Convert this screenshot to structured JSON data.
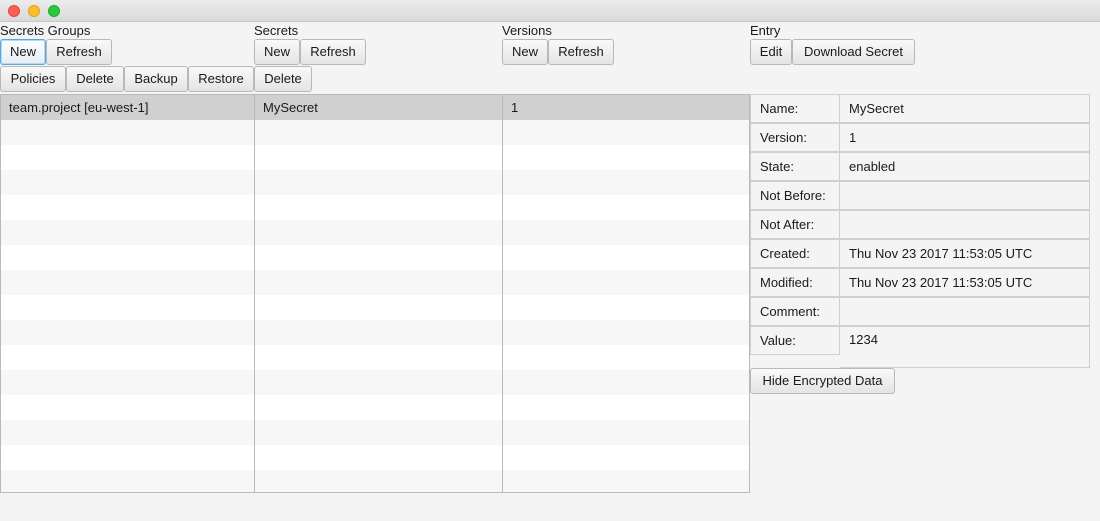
{
  "window": {
    "controls": [
      "close",
      "minimize",
      "maximize"
    ]
  },
  "groups": {
    "label": "Secrets Groups",
    "new_label": "New",
    "refresh_label": "Refresh",
    "policies_label": "Policies",
    "delete_label": "Delete",
    "backup_label": "Backup",
    "restore_label": "Restore",
    "items": [
      "team.project [eu-west-1]"
    ]
  },
  "secrets": {
    "label": "Secrets",
    "new_label": "New",
    "refresh_label": "Refresh",
    "delete_label": "Delete",
    "items": [
      "MySecret"
    ]
  },
  "versions": {
    "label": "Versions",
    "new_label": "New",
    "refresh_label": "Refresh",
    "items": [
      "1"
    ]
  },
  "entry": {
    "label": "Entry",
    "edit_label": "Edit",
    "download_label": "Download Secret",
    "hide_label": "Hide Encrypted Data",
    "fields": [
      {
        "key": "Name:",
        "value": "MySecret"
      },
      {
        "key": "Version:",
        "value": "1"
      },
      {
        "key": "State:",
        "value": "enabled"
      },
      {
        "key": "Not Before:",
        "value": ""
      },
      {
        "key": "Not After:",
        "value": ""
      },
      {
        "key": "Created:",
        "value": "Thu Nov 23 2017 11:53:05 UTC"
      },
      {
        "key": "Modified:",
        "value": "Thu Nov 23 2017 11:53:05 UTC"
      },
      {
        "key": "Comment:",
        "value": ""
      },
      {
        "key": "Value:",
        "value": "1234"
      }
    ]
  }
}
